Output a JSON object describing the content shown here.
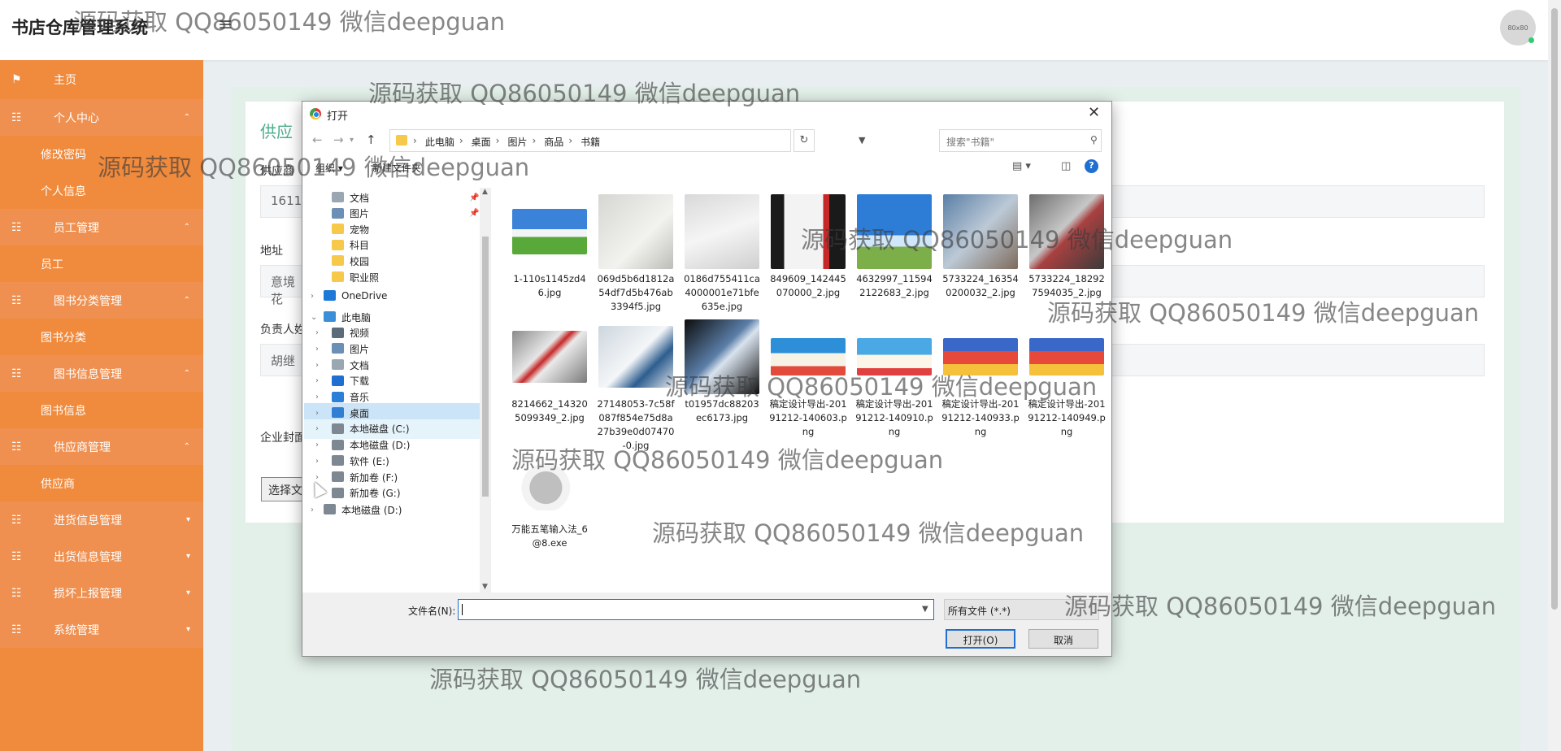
{
  "header": {
    "app_title": "书店仓库管理系统",
    "menu_toggle": "≡",
    "avatar_text": "80x80"
  },
  "sidebar": {
    "home": "主页",
    "groups": [
      {
        "label": "个人中心",
        "children": [
          "修改密码",
          "个人信息"
        ]
      },
      {
        "label": "员工管理",
        "children": [
          "员工"
        ]
      },
      {
        "label": "图书分类管理",
        "children": [
          "图书分类"
        ]
      },
      {
        "label": "图书信息管理",
        "children": [
          "图书信息"
        ]
      },
      {
        "label": "供应商管理",
        "children": [
          "供应商"
        ]
      },
      {
        "label": "进货信息管理",
        "children": []
      },
      {
        "label": "出货信息管理",
        "children": []
      },
      {
        "label": "损坏上报管理",
        "children": []
      },
      {
        "label": "系统管理",
        "children": []
      }
    ]
  },
  "form": {
    "title_partial": "供应",
    "field1_label_partial": "供应商",
    "field1_value_partial": "1611",
    "address_label": "地址",
    "address_value_partial": "意境花",
    "contact_label_partial": "负责人姓",
    "contact_value_partial": "胡继",
    "logo_label_partial": "企业封面",
    "choose_file_partial": "选择文"
  },
  "dialog": {
    "title": "打开",
    "close": "✕",
    "breadcrumbs": [
      "此电脑",
      "桌面",
      "图片",
      "商品",
      "书籍"
    ],
    "search_placeholder": "搜索\"书籍\"",
    "organize": "组织 ▾",
    "new_folder": "新建文件夹",
    "nav_tree": [
      {
        "label": "文档",
        "level": 1,
        "icon": "document-icon",
        "pinned": true
      },
      {
        "label": "图片",
        "level": 1,
        "icon": "picture-icon",
        "pinned": true
      },
      {
        "label": "宠物",
        "level": 1,
        "icon": "folder-icon"
      },
      {
        "label": "科目",
        "level": 1,
        "icon": "folder-icon"
      },
      {
        "label": "校园",
        "level": 1,
        "icon": "folder-icon"
      },
      {
        "label": "职业照",
        "level": 1,
        "icon": "folder-icon"
      },
      {
        "label": "OneDrive",
        "level": 0,
        "icon": "cloud-icon",
        "expandable": true
      },
      {
        "label": "此电脑",
        "level": 0,
        "icon": "computer-icon",
        "expanded": true
      },
      {
        "label": "视频",
        "level": 1,
        "icon": "video-icon",
        "expandable": true
      },
      {
        "label": "图片",
        "level": 1,
        "icon": "picture-icon",
        "expandable": true
      },
      {
        "label": "文档",
        "level": 1,
        "icon": "document-icon",
        "expandable": true
      },
      {
        "label": "下载",
        "level": 1,
        "icon": "download-icon",
        "expandable": true
      },
      {
        "label": "音乐",
        "level": 1,
        "icon": "music-icon",
        "expandable": true
      },
      {
        "label": "桌面",
        "level": 1,
        "icon": "desktop-icon",
        "expandable": true,
        "selected": true
      },
      {
        "label": "本地磁盘 (C:)",
        "level": 1,
        "icon": "drive-icon",
        "expandable": true,
        "hover": true
      },
      {
        "label": "本地磁盘 (D:)",
        "level": 1,
        "icon": "drive-icon",
        "expandable": true
      },
      {
        "label": "软件 (E:)",
        "level": 1,
        "icon": "drive-icon",
        "expandable": true
      },
      {
        "label": "新加卷 (F:)",
        "level": 1,
        "icon": "drive-icon",
        "expandable": true
      },
      {
        "label": "新加卷 (G:)",
        "level": 1,
        "icon": "drive-icon",
        "expandable": true
      },
      {
        "label": "本地磁盘 (D:)",
        "level": 0,
        "icon": "drive-icon",
        "expandable": true
      }
    ],
    "files": [
      {
        "name": "1-110s1145zd46.jpg",
        "thumb": "landscape"
      },
      {
        "name": "069d5b6d1812a54df7d5b476ab3394f5.jpg",
        "thumb": "notebook"
      },
      {
        "name": "0186d755411ca4000001e71bfe635e.jpg",
        "thumb": "book-white"
      },
      {
        "name": "849609_142445070000_2.jpg",
        "thumb": "book-red"
      },
      {
        "name": "4632997_115942122683_2.jpg",
        "thumb": "sky"
      },
      {
        "name": "5733224_163540200032_2.jpg",
        "thumb": "book-blue"
      },
      {
        "name": "5733224_182927594035_2.jpg",
        "thumb": "book-dark"
      },
      {
        "name": "8214662_143205099349_2.jpg",
        "thumb": "book-grey"
      },
      {
        "name": "27148053-7c58f087f854e75d8a27b39e0d07470-0.jpg",
        "thumb": "book-light"
      },
      {
        "name": "t01957dc88203ec6173.jpg",
        "thumb": "box-blue"
      },
      {
        "name": "稿定设计导出-20191212-140603.png",
        "thumb": "banner-a"
      },
      {
        "name": "稿定设计导出-20191212-140910.png",
        "thumb": "banner-b"
      },
      {
        "name": "稿定设计导出-20191212-140933.png",
        "thumb": "banner-c"
      },
      {
        "name": "稿定设计导出-20191212-140949.png",
        "thumb": "banner-c"
      },
      {
        "name": "万能五笔输入法_6@8.exe",
        "thumb": "installer"
      }
    ],
    "filename_label": "文件名(N):",
    "filename_value": "",
    "file_type": "所有文件 (*.*)",
    "open_button": "打开(O)",
    "cancel_button": "取消"
  },
  "watermark_text": "源码获取 QQ86050149 微信deepguan",
  "colors": {
    "sidebar": "#f08a3c",
    "accent": "#1f6fd0",
    "form_title": "#4caf8a"
  }
}
